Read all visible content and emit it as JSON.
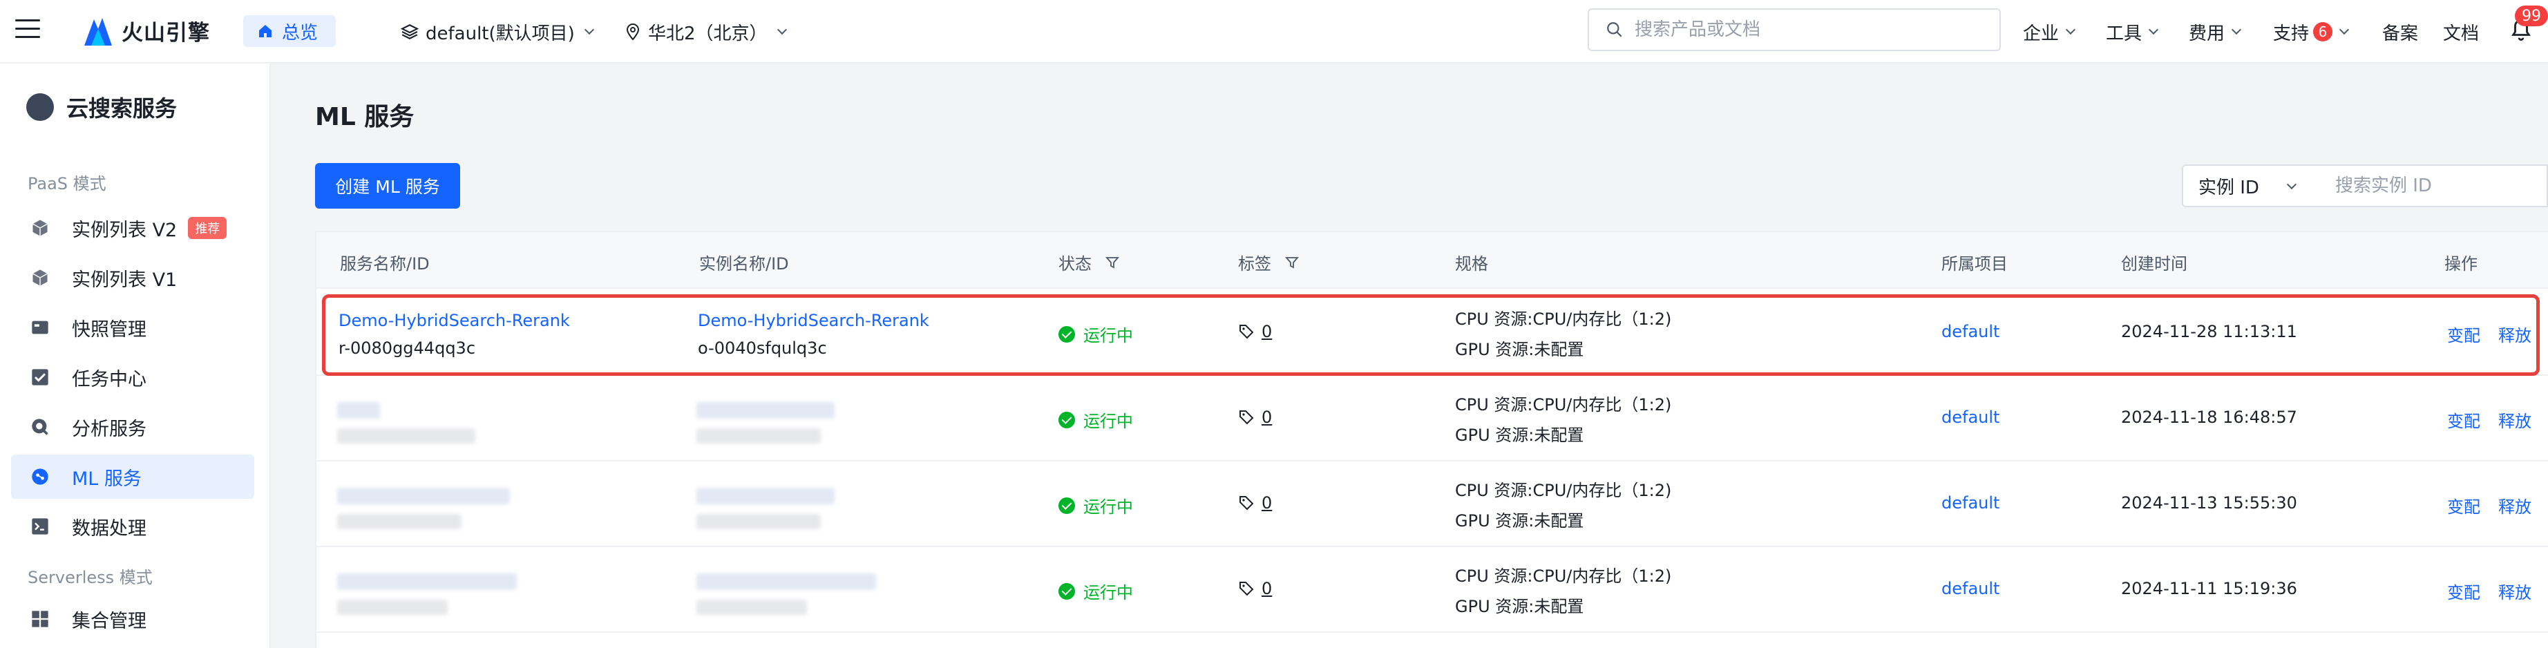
{
  "topbar": {
    "logo_text": "火山引擎",
    "home_label": "总览",
    "project": "default(默认项目)",
    "region": "华北2（北京）",
    "search_placeholder": "搜索产品或文档",
    "menus": {
      "enterprise": "企业",
      "tools": "工具",
      "billing": "费用",
      "support": "支持",
      "support_badge": "6",
      "filing": "备案",
      "docs": "文档"
    },
    "bell_badge": "99"
  },
  "sidebar": {
    "service_title": "云搜索服务",
    "group_paas": "PaaS 模式",
    "group_serverless": "Serverless 模式",
    "items": [
      {
        "label": "实例列表 V2",
        "badge": "推荐"
      },
      {
        "label": "实例列表 V1"
      },
      {
        "label": "快照管理"
      },
      {
        "label": "任务中心"
      },
      {
        "label": "分析服务"
      },
      {
        "label": "ML 服务"
      },
      {
        "label": "数据处理"
      },
      {
        "label": "集合管理"
      }
    ]
  },
  "main": {
    "title": "ML 服务",
    "create_button": "创建 ML 服务",
    "filter_field": "实例 ID",
    "filter_placeholder": "搜索实例 ID",
    "columns": {
      "service": "服务名称/ID",
      "instance": "实例名称/ID",
      "status": "状态",
      "tags": "标签",
      "spec": "规格",
      "project": "所属项目",
      "created": "创建时间",
      "actions": "操作"
    },
    "rows": [
      {
        "service_name": "Demo-HybridSearch-Rerank",
        "service_id": "r-0080gg44qq3c",
        "instance_name": "Demo-HybridSearch-Rerank",
        "instance_id": "o-0040sfqulq3c",
        "status": "运行中",
        "tags": "0",
        "cpu": "CPU 资源:CPU/内存比（1:2)",
        "gpu": "GPU 资源:未配置",
        "project": "default",
        "created": "2024-11-28 11:13:11",
        "action_modify": "变配",
        "action_release": "释放"
      },
      {
        "status": "运行中",
        "tags": "0",
        "cpu": "CPU 资源:CPU/内存比（1:2)",
        "gpu": "GPU 资源:未配置",
        "project": "default",
        "created": "2024-11-18 16:48:57",
        "action_modify": "变配",
        "action_release": "释放"
      },
      {
        "status": "运行中",
        "tags": "0",
        "cpu": "CPU 资源:CPU/内存比（1:2)",
        "gpu": "GPU 资源:未配置",
        "project": "default",
        "created": "2024-11-13 15:55:30",
        "action_modify": "变配",
        "action_release": "释放"
      },
      {
        "status": "运行中",
        "tags": "0",
        "cpu": "CPU 资源:CPU/内存比（1:2)",
        "gpu": "GPU 资源:未配置",
        "project": "default",
        "created": "2024-11-11 15:19:36",
        "action_modify": "变配",
        "action_release": "释放"
      }
    ]
  },
  "colors": {
    "accent": "#1664ff",
    "success": "#00b42a",
    "danger": "#f53f3f",
    "highlight_border": "#e8403c"
  }
}
